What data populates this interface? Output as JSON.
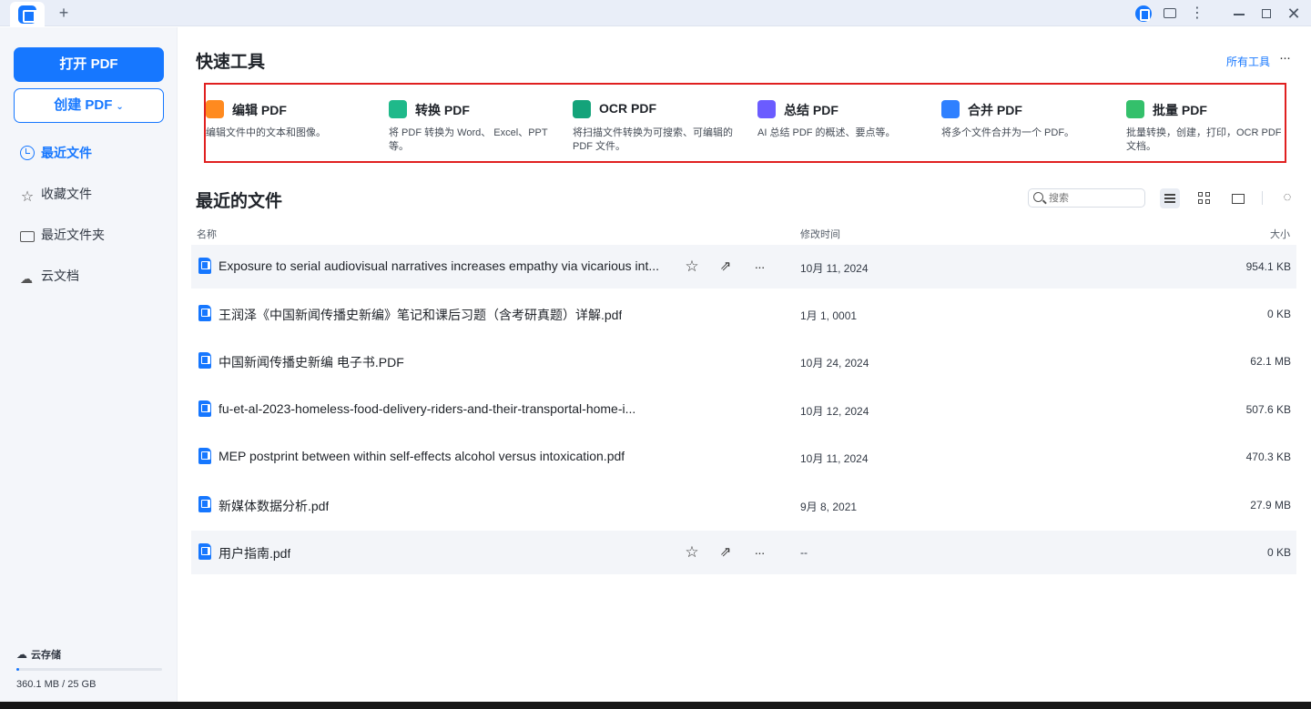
{
  "titlebar": {
    "new_tab_glyph": "+",
    "icons": [
      "app-logo-icon",
      "account-logo-icon",
      "message-icon",
      "more-vertical-icon",
      "minimize-icon",
      "maximize-icon",
      "close-icon"
    ],
    "more_glyph": "⋮",
    "close_glyph": "✕"
  },
  "sidebar": {
    "open_pdf": "打开 PDF",
    "create_pdf": "创建 PDF",
    "create_chevron": "⌄",
    "nav": [
      {
        "label": "最近文件",
        "icon": "clock-icon",
        "active": true
      },
      {
        "label": "收藏文件",
        "icon": "star-icon"
      },
      {
        "label": "最近文件夹",
        "icon": "folder-icon"
      },
      {
        "label": "云文档",
        "icon": "cloud-icon"
      }
    ],
    "star_glyph": "☆",
    "cloud_glyph": "☁",
    "storage": {
      "label": "云存储",
      "used_text": "360.1 MB / 25 GB",
      "used_fraction": 0.014
    }
  },
  "quick_tools": {
    "title": "快速工具",
    "all_tools": "所有工具",
    "more": "···",
    "tools": [
      {
        "title": "编辑 PDF",
        "desc": "编辑文件中的文本和图像。",
        "icon": "edit-pdf-icon",
        "color": "#ff8a1f"
      },
      {
        "title": "转换 PDF",
        "desc": "将 PDF 转换为 Word、 Excel、PPT等。",
        "icon": "convert-pdf-icon",
        "color": "#1fb98a"
      },
      {
        "title": "OCR PDF",
        "desc": "将扫描文件转换为可搜索、可编辑的 PDF 文件。",
        "icon": "ocr-pdf-icon",
        "color": "#14a37a"
      },
      {
        "title": "总结 PDF",
        "desc": "AI 总结 PDF 的概述、要点等。",
        "icon": "summarize-pdf-icon",
        "color": "#6b5cff"
      },
      {
        "title": "合并 PDF",
        "desc": "将多个文件合并为一个 PDF。",
        "icon": "merge-pdf-icon",
        "color": "#2f80ff"
      },
      {
        "title": "批量 PDF",
        "desc": "批量转换，创建，打印，OCR PDF 文档。",
        "icon": "batch-pdf-icon",
        "color": "#34c06b"
      }
    ]
  },
  "recent": {
    "title": "最近的文件",
    "search_placeholder": "搜索",
    "refresh_glyph": "◌",
    "columns": {
      "name": "名称",
      "modified": "修改时间",
      "size": "大小"
    },
    "row_actions": {
      "star": "☆",
      "share": "⇗",
      "more": "···"
    },
    "files": [
      {
        "name": "Exposure to serial audiovisual narratives increases empathy via vicarious int...",
        "date": "10月 11, 2024",
        "size": "954.1 KB",
        "hover": true
      },
      {
        "name": "王润泽《中国新闻传播史新编》笔记和课后习题（含考研真题）详解.pdf",
        "date": "1月 1, 0001",
        "size": "0 KB"
      },
      {
        "name": "中国新闻传播史新编 电子书.PDF",
        "date": "10月 24, 2024",
        "size": "62.1 MB"
      },
      {
        "name": "fu-et-al-2023-homeless-food-delivery-riders-and-their-transportal-home-i...",
        "date": "10月 12, 2024",
        "size": "507.6 KB"
      },
      {
        "name": "MEP postprint between within self-effects alcohol versus intoxication.pdf",
        "date": "10月 11, 2024",
        "size": "470.3 KB"
      },
      {
        "name": "新媒体数据分析.pdf",
        "date": "9月 8, 2021",
        "size": "27.9 MB"
      },
      {
        "name": "用户指南.pdf",
        "date": "--",
        "size": "0 KB",
        "hover": true
      }
    ]
  },
  "colors": {
    "accent": "#1677ff",
    "highlight_frame": "#e02020"
  }
}
